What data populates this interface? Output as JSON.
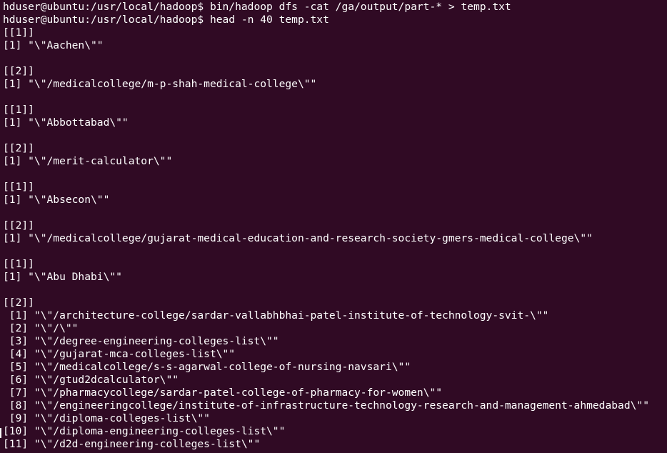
{
  "terminal": {
    "background": "#300a24",
    "foreground": "#ffffff",
    "lines": [
      "hduser@ubuntu:/usr/local/hadoop$ bin/hadoop dfs -cat /ga/output/part-* > temp.txt",
      "hduser@ubuntu:/usr/local/hadoop$ head -n 40 temp.txt",
      "[[1]]",
      "[1] \"\\\"Aachen\\\"\"",
      "",
      "[[2]]",
      "[1] \"\\\"/medicalcollege/m-p-shah-medical-college\\\"\"",
      "",
      "[[1]]",
      "[1] \"\\\"Abbottabad\\\"\"",
      "",
      "[[2]]",
      "[1] \"\\\"/merit-calculator\\\"\"",
      "",
      "[[1]]",
      "[1] \"\\\"Absecon\\\"\"",
      "",
      "[[2]]",
      "[1] \"\\\"/medicalcollege/gujarat-medical-education-and-research-society-gmers-medical-college\\\"\"",
      "",
      "[[1]]",
      "[1] \"\\\"Abu Dhabi\\\"\"",
      "",
      "[[2]]",
      " [1] \"\\\"/architecture-college/sardar-vallabhbhai-patel-institute-of-technology-svit-\\\"\"",
      " [2] \"\\\"/\\\"\"",
      " [3] \"\\\"/degree-engineering-colleges-list\\\"\"",
      " [4] \"\\\"/gujarat-mca-colleges-list\\\"\"",
      " [5] \"\\\"/medicalcollege/s-s-agarwal-college-of-nursing-navsari\\\"\"",
      " [6] \"\\\"/gtud2dcalculator\\\"\"",
      " [7] \"\\\"/pharmacycollege/sardar-patel-college-of-pharmacy-for-women\\\"\"",
      " [8] \"\\\"/engineeringcollege/institute-of-infrastructure-technology-research-and-management-ahmedabad\\\"\"",
      " [9] \"\\\"/diploma-colleges-list\\\"\"",
      "[10] \"\\\"/diploma-engineering-colleges-list\\\"\"",
      "[11] \"\\\"/d2d-engineering-colleges-list\\\"\""
    ]
  }
}
